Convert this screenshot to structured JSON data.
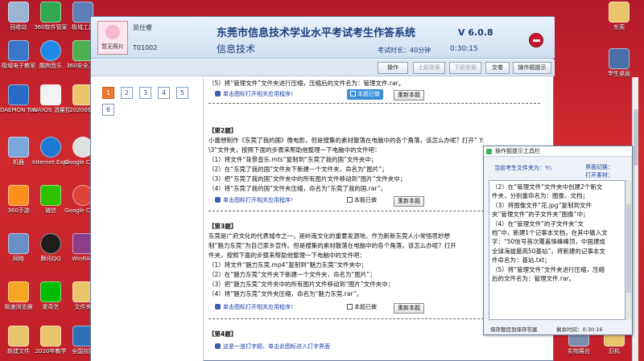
{
  "desktop": {
    "icons": [
      {
        "label": "回收站"
      },
      {
        "label": "360软件管家"
      },
      {
        "label": "极域工具"
      },
      {
        "label": "极域电子教室"
      },
      {
        "label": "酷狗音乐"
      },
      {
        "label": "360安全卫士"
      },
      {
        "label": "DAEMON Tools Lite"
      },
      {
        "label": "WAYOS 流量控制"
      },
      {
        "label": "202009..."
      },
      {
        "label": "机器"
      },
      {
        "label": "Internet Explorer"
      },
      {
        "label": "Google Chrome"
      },
      {
        "label": "360手游"
      },
      {
        "label": "微信"
      },
      {
        "label": "Google Chrome"
      },
      {
        "label": "网络"
      },
      {
        "label": "腾讯QQ"
      },
      {
        "label": "WinRAR"
      },
      {
        "label": "极速浏览器"
      },
      {
        "label": "爱奇艺"
      },
      {
        "label": "文件夹"
      },
      {
        "label": "新建文件"
      },
      {
        "label": "2020年教学"
      },
      {
        "label": "全国技能"
      },
      {
        "label": "实物展台"
      },
      {
        "label": "旧机"
      },
      {
        "label": "学生桌面"
      },
      {
        "label": "东莞"
      }
    ]
  },
  "exam": {
    "student_name": "吴仕睿",
    "student_id": "T01002",
    "photo_label": "暂无照片",
    "title": "东莞市信息技术学业水平考试考生作答系统",
    "subject": "信息技术",
    "version": "V 6.0.8",
    "duration_label": "考试时长：40分钟",
    "remaining_clock": "0:30:15",
    "toolbar": {
      "help": "操作",
      "prev": "上题答案",
      "next": "下题答案",
      "submit": "交卷",
      "hint": "操作题提示"
    },
    "question_numbers": [
      "1",
      "2",
      "3",
      "4",
      "5",
      "6"
    ],
    "q_top": {
      "step5": "（5）将“管理文件”文件夹进行压缩，压缩后的文件名为：管理文件.rar。",
      "link": "单击图标打开相关应用程序!",
      "done_label": "本题已做",
      "reset_label": "重新本题"
    },
    "q2": {
      "heading": "【第2题】",
      "body1": "小蕾想制作《东莞了我的国》微电影，但是搜集的素材散落在电脑中的各个角落，该怎么办呢？打开“ Y:",
      "body2": "\\3”文件夹，按照下面的步骤来帮助他整理一下电脑中的文件吧：",
      "s1": "（1）将文件“背景音乐.mts”复制到“东莞了我的国”文件夹中；",
      "s2": "（2）在“东莞了我的国”文件夹下新建一个文件夹，命名为“图片”；",
      "s3": "（3）把“东莞了我的国”文件夹中的所有图片文件移动到“图片”文件夹中；",
      "s4": "（4）将“东莞了我的国”文件夹压缩，命名为“东莞了我的国.rar”。",
      "link": "单击图标打开相关应用程序!",
      "done_label": "本题已做",
      "reset_label": "重新本题"
    },
    "q3": {
      "heading": "【第3题】",
      "body1": "东莞是广府文化的代表城市之一，是岭南文化的重要发源地。作为新新东莞人小常悟思妙想",
      "body2": "制“魅力东莞”为自己家乡宣传。但是搜集的素材散落在电脑中的各个角落，该怎么办呢？打开",
      "body3": "件夹，按照下面的步骤来帮助他整理一下电脑中的文件吧：",
      "s1": "（1）将文件“魅力东莞.mp4”复制到“魅力东莞”文件夹中；",
      "s2": "（2）在“魅力东莞”文件夹下新建一个文件夹，命名为“图片”；",
      "s3": "（3）把“魅力东莞”文件夹中的所有图片文件移动到“图片”文件夹中；",
      "s4": "（4）将“魅力东莞”文件夹压缩，命名为“魅力东莞.rar”。",
      "link": "单击图标打开相关应用程序!",
      "done_label": "本题已做",
      "reset_label": "重新本题"
    },
    "q4": {
      "heading": "【第4题】",
      "link": "这是一道打字题，单击此图标进入打字界面"
    }
  },
  "tool": {
    "title": "操作题提示工具栏",
    "folder_label": "当前考生文件夹为：Y:\\",
    "mode_label": "界面切换：",
    "open_label": "打开素材：",
    "lines": [
      "（2）在“管理文件”文件夹中创建2个新文",
      "件夹，分别重命名为：图像、文档；",
      "（3）将图像文件“花.jpg”复制到文件",
      "夹“管理文件”的子文件夹“图像”中；",
      "（4）在“管理文件”的子文件夹“文",
      "档”中，新建1个记事本文档，在其中输入文",
      "字：“50信号首次覆盖珠峰峰顶，中国建成",
      "全球海拔最高50基站”，将新建的记事本文",
      "件命名为：基站.txt；",
      "（5）将“管理文件”文件夹进行压缩，压缩",
      "后的文件名为：管理文件.rar。"
    ],
    "save_button": "保存题目到保存答案",
    "remaining": "剩余时间：0:30:16"
  }
}
